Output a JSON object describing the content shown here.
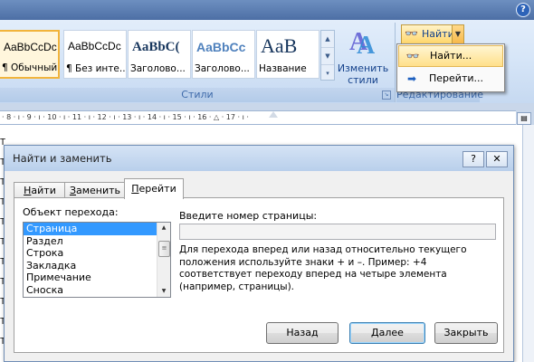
{
  "ribbon": {
    "help_icon": "?",
    "styles": [
      {
        "sample": "AaBbCcDc",
        "name": "¶ Обычный",
        "selected": true
      },
      {
        "sample": "AaBbCcDc",
        "name": "¶ Без инте..."
      },
      {
        "sample": "AaBbC(",
        "name": "Заголово..."
      },
      {
        "sample": "AaBbCc",
        "name": "Заголово..."
      },
      {
        "sample": "AaB",
        "name": "Название"
      }
    ],
    "change_styles_label": "Изменить стили",
    "styles_group_label": "Стили",
    "find_button_label": "Найти",
    "editing_group_label": "Редактирование",
    "find_menu": [
      {
        "label": "Найти...",
        "icon": "binoculars-icon",
        "highlighted": true
      },
      {
        "label": "Перейти...",
        "icon": "arrow-right-icon"
      }
    ]
  },
  "ruler": {
    "text": "· 8 · ı · 9 · ı · 10 · ı · 11 · ı · 12 · ı · 13 · ı · 14 · ı · 15 · ı · 16 · △ · 17 · ı ·"
  },
  "document": {
    "row_prefix": "T"
  },
  "dialog": {
    "title": "Найти и заменить",
    "help_btn": "?",
    "close_btn": "✕",
    "tabs": [
      {
        "label": "Найти",
        "ul": "Н",
        "rest": "айти"
      },
      {
        "label": "Заменить",
        "ul": "З",
        "rest": "аменить"
      },
      {
        "label": "Перейти",
        "ul": "П",
        "rest": "ерейти",
        "active": true
      }
    ],
    "goto_label": "Объект перехода:",
    "goto_items": [
      "Страница",
      "Раздел",
      "Строка",
      "Закладка",
      "Примечание",
      "Сноска"
    ],
    "selected_index": 0,
    "page_label": "Введите номер страницы:",
    "page_value": "",
    "hint": "Для перехода вперед или назад относительно текущего положения используйте знаки + и –. Пример: +4 соответствует переходу вперед на четыре элемента (например, страницы).",
    "buttons": {
      "back": "Назад",
      "next": "Далее",
      "close": "Закрыть"
    }
  },
  "colors": {
    "ribbon_bg": "#dbe8f8",
    "selection_blue": "#3399ff",
    "highlight_gold": "#ffe08a",
    "group_label": "#3e6aaa"
  }
}
